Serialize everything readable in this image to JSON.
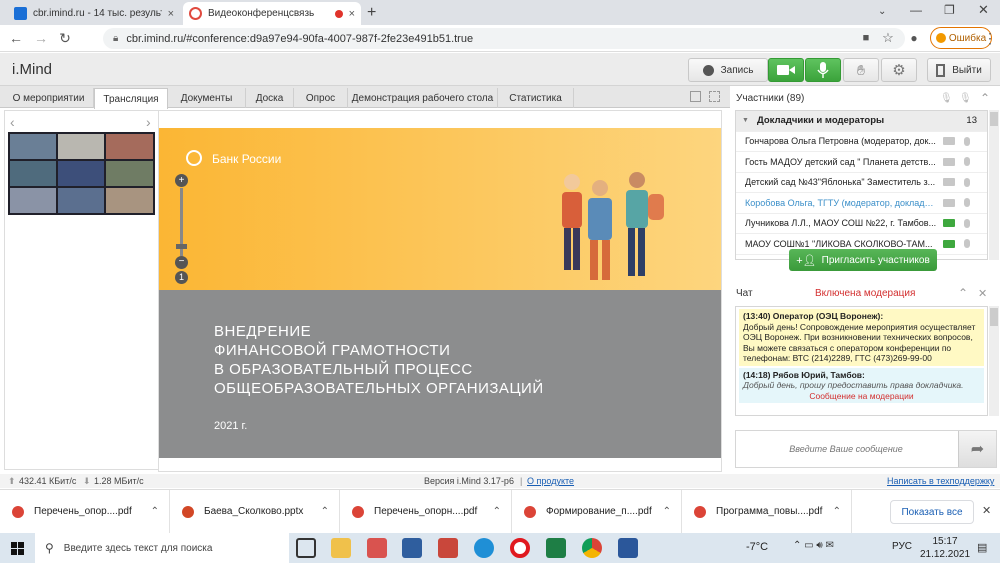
{
  "browser": {
    "tabs": [
      {
        "title": "cbr.imind.ru - 14 тыс. результато",
        "close": "×"
      },
      {
        "title": "Видеоконференцсвязь",
        "close": "×"
      }
    ],
    "new_tab": "+",
    "url": "cbr.imind.ru/#conference:d9a97e94-90fa-4007-987f-2fe23e491b51.true",
    "error_label": "Ошибка"
  },
  "app": {
    "logo": "i.Mind",
    "record_label": "Запись",
    "exit_label": "Выйти",
    "accent_green": "#3ba33b"
  },
  "subtabs": [
    "О мероприятии",
    "Трансляция",
    "Документы",
    "Доска",
    "Опрос",
    "Демонстрация рабочего стола",
    "Статистика"
  ],
  "slide": {
    "brand": "Банк России",
    "title": "ВНЕДРЕНИЕ\nФИНАНСОВОЙ ГРАМОТНОСТИ\nВ ОБРАЗОВАТЕЛЬНЫЙ ПРОЦЕСС\nОБЩЕОБРАЗОВАТЕЛЬНЫХ ОРГАНИЗАЦИЙ",
    "year": "2021 г."
  },
  "participants": {
    "header": "Участники (89)",
    "group_label": "Докладчики и модераторы",
    "group_count": "13",
    "rows": [
      {
        "name": "Гончарова Ольга Петровна (модератор, док...",
        "color": "#222",
        "cam": false
      },
      {
        "name": "Гость МАДОУ детский сад \" Планета детств...",
        "color": "#222",
        "cam": false
      },
      {
        "name": "Детский сад №43\"Яблонька\" Заместитель з...",
        "color": "#222",
        "cam": false
      },
      {
        "name": "Коробова Ольга, ТГТУ (модератор, докладчик)",
        "color": "#3b8fc9",
        "cam": false
      },
      {
        "name": "Лучникова Л.Л., МАОУ СОШ №22, г. Тамбов...",
        "color": "#222",
        "cam": true
      },
      {
        "name": "МАОУ СОШ№1 \"ЛИКОВА СКОЛКОВО-ТАМ...",
        "color": "#222",
        "cam": true
      }
    ],
    "invite_label": "Пригласить участников"
  },
  "chat": {
    "header": "Чат",
    "moderation": "Включена модерация",
    "messages": [
      {
        "author": "(13:40) Оператор (ОЭЦ Воронеж):",
        "text": "Добрый день! Сопровождение мероприятия осуществляет ОЭЦ Воронеж. При возникновении технических вопросов, Вы можете связаться с оператором конференции по телефонам: ВТС (214)2289, ГТС (473)269-99-00"
      },
      {
        "author": "(14:18) Рябов Юрий, Тамбов:",
        "text": "Добрый день, прошу предоставить права докладчика.",
        "status": "Сообщение на модерации"
      }
    ],
    "input_placeholder": "Введите Ваше сообщение"
  },
  "status": {
    "upload": "432.41 КБит/с",
    "download": "1.28 МБит/с",
    "version": "Версия i.Mind 3.17-p6",
    "about": "О продукте",
    "support": "Написать в техподдержку"
  },
  "downloads": {
    "items": [
      "Перечень_опор....pdf",
      "Баева_Сколково.pptx",
      "Перечень_опорн....pdf",
      "Формирование_п....pdf",
      "Программа_повы....pdf"
    ],
    "show_all": "Показать все"
  },
  "taskbar": {
    "search_placeholder": "Введите здесь текст для поиска",
    "weather": "-7°C",
    "lang": "РУС",
    "time": "15:17",
    "date": "21.12.2021"
  }
}
